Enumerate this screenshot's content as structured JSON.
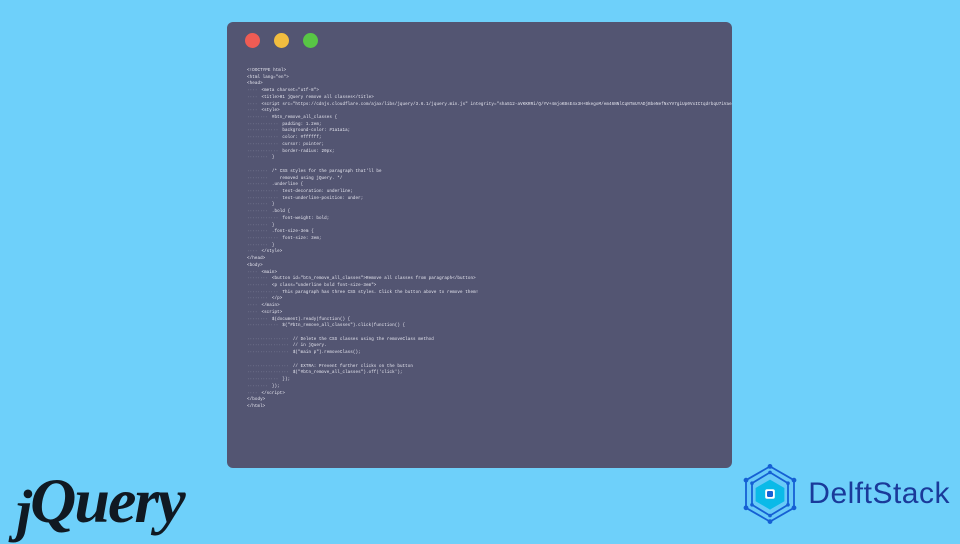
{
  "editor": {
    "code_lines": [
      {
        "indent": 0,
        "text": "<!DOCTYPE html>"
      },
      {
        "indent": 0,
        "text": "<html lang=\"en\">"
      },
      {
        "indent": 0,
        "text": "<head>"
      },
      {
        "indent": 1,
        "text": "<meta charset=\"utf-8\">"
      },
      {
        "indent": 1,
        "text": "<title>01 jQuery remove all classes</title>"
      },
      {
        "indent": 1,
        "text": "<script src=\"https://cdnjs.cloudflare.com/ajax/libs/jquery/3.6.1/jquery.min.js\" integrity=\"sha512-aVKKRRi/Q/YV+4mjoKBsE4x3H+BkegoM/em46NNlCqNTmUYADjBbeNefNxYV7giUp0VxICtqdrbqU7iVaeZNXA==\" crossorigin=\"anonymous\" referrerpolicy=\"no-referrer\"></script>"
      },
      {
        "indent": 1,
        "text": "<style>"
      },
      {
        "indent": 2,
        "text": "#btn_remove_all_classes {"
      },
      {
        "indent": 3,
        "text": "padding: 1.2em;"
      },
      {
        "indent": 3,
        "text": "background-color: #1a1a1a;"
      },
      {
        "indent": 3,
        "text": "color: #ffffff;"
      },
      {
        "indent": 3,
        "text": "cursor: pointer;"
      },
      {
        "indent": 3,
        "text": "border-radius: 20px;"
      },
      {
        "indent": 2,
        "text": "}"
      },
      {
        "indent": 0,
        "text": ""
      },
      {
        "indent": 2,
        "text": "/* CSS styles for the paragraph that'll be"
      },
      {
        "indent": 2,
        "text": "   removed using jQuery. */"
      },
      {
        "indent": 2,
        "text": ".underline {"
      },
      {
        "indent": 3,
        "text": "text-decoration: underline;"
      },
      {
        "indent": 3,
        "text": "text-underline-position: under;"
      },
      {
        "indent": 2,
        "text": "}"
      },
      {
        "indent": 2,
        "text": ".bold {"
      },
      {
        "indent": 3,
        "text": "font-weight: bold;"
      },
      {
        "indent": 2,
        "text": "}"
      },
      {
        "indent": 2,
        "text": ".font-size-3em {"
      },
      {
        "indent": 3,
        "text": "font-size: 3em;"
      },
      {
        "indent": 2,
        "text": "}"
      },
      {
        "indent": 1,
        "text": "</style>"
      },
      {
        "indent": 0,
        "text": "</head>"
      },
      {
        "indent": 0,
        "text": "<body>"
      },
      {
        "indent": 1,
        "text": "<main>"
      },
      {
        "indent": 2,
        "text": "<button id=\"btn_remove_all_classes\">Remove all classes from paragraph</button>"
      },
      {
        "indent": 2,
        "text": "<p class=\"underline bold font-size-3em\">"
      },
      {
        "indent": 3,
        "text": "This paragraph has three CSS styles. Click the button above to remove them!"
      },
      {
        "indent": 2,
        "text": "</p>"
      },
      {
        "indent": 1,
        "text": "</main>"
      },
      {
        "indent": 1,
        "text": "<script>"
      },
      {
        "indent": 2,
        "text": "$(document).ready(function() {"
      },
      {
        "indent": 3,
        "text": "$(\"#btn_remove_all_classes\").click(function() {"
      },
      {
        "indent": 0,
        "text": ""
      },
      {
        "indent": 4,
        "text": "// Delete the CSS classes using the removeClass method"
      },
      {
        "indent": 4,
        "text": "// in jQuery."
      },
      {
        "indent": 4,
        "text": "$(\"main p\").removeClass();"
      },
      {
        "indent": 0,
        "text": ""
      },
      {
        "indent": 4,
        "text": "// EXTRA: Prevent further clicks on the button"
      },
      {
        "indent": 4,
        "text": "$(\"#btn_remove_all_classes\").off('click');"
      },
      {
        "indent": 3,
        "text": "});"
      },
      {
        "indent": 2,
        "text": "});"
      },
      {
        "indent": 1,
        "text": "</script>"
      },
      {
        "indent": 0,
        "text": "</body>"
      },
      {
        "indent": 0,
        "text": "</html>"
      }
    ]
  },
  "brands": {
    "jquery": "jQuery",
    "delftstack": "DelftStack"
  },
  "colors": {
    "background": "#6ed0fa",
    "editor_bg": "#535572",
    "dot_red": "#ee5c54",
    "dot_yellow": "#f2bd3f",
    "dot_green": "#58c645",
    "brand_blue": "#1a3a9a"
  }
}
